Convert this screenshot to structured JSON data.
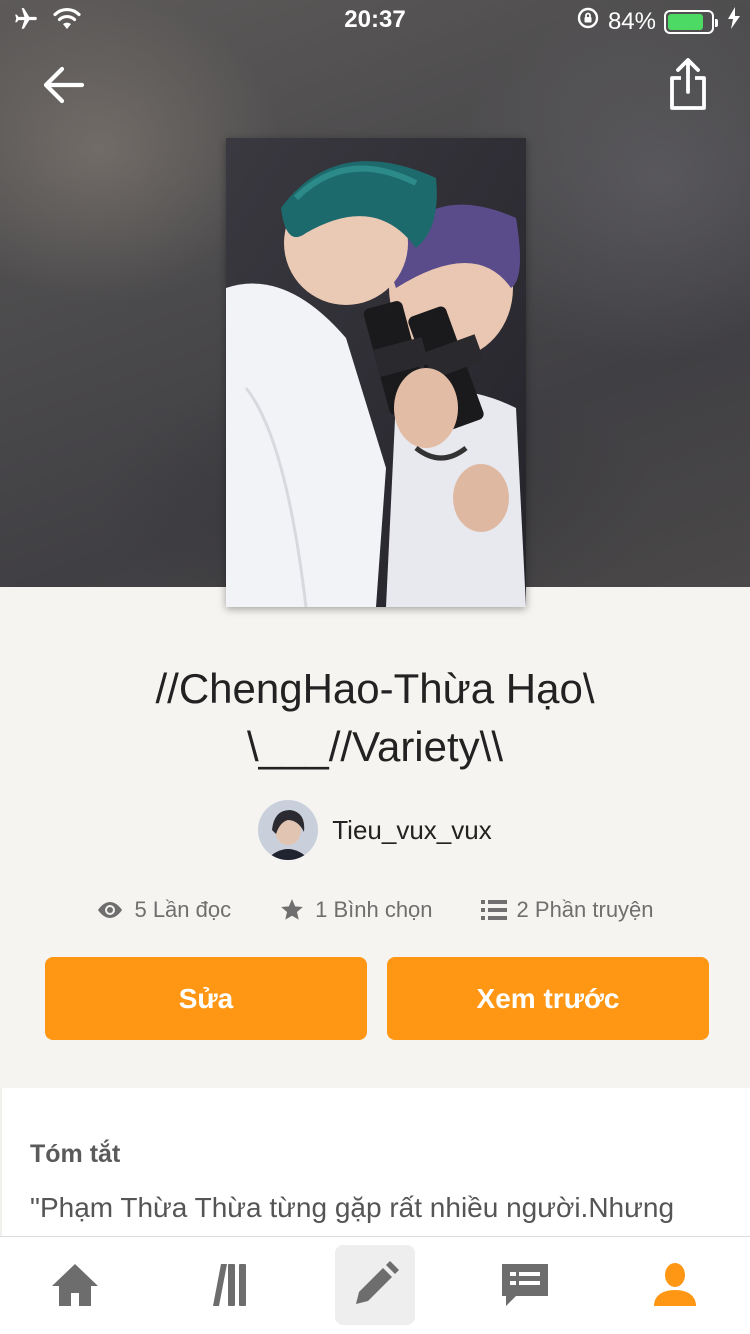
{
  "status_bar": {
    "time": "20:37",
    "battery_percent": "84%",
    "battery_level": 0.84,
    "icons": [
      "airplane-icon",
      "wifi-icon",
      "rotation-lock-icon",
      "battery-icon",
      "charging-icon"
    ]
  },
  "nav": {
    "back_icon": "arrow-left-icon",
    "share_icon": "share-icon"
  },
  "story": {
    "title": "//ChengHao-Thừa Hạo\\\n\\___//Variety\\\\",
    "author": "Tieu_vux_vux",
    "reads": "5 Lần đọc",
    "votes": "1 Bình chọn",
    "parts": "2 Phần truyện"
  },
  "actions": {
    "edit_label": "Sửa",
    "preview_label": "Xem trước"
  },
  "summary": {
    "heading": "Tóm tắt",
    "text": "\"Phạm Thừa Thừa từng gặp rất nhiều người.Nhưng"
  },
  "colors": {
    "accent": "#ff9614",
    "background": "#f5f4f0",
    "battery": "#4cd964"
  },
  "tabs": [
    {
      "name": "home",
      "icon": "home-icon"
    },
    {
      "name": "library",
      "icon": "library-icon"
    },
    {
      "name": "write",
      "icon": "pencil-icon",
      "selected": true
    },
    {
      "name": "messages",
      "icon": "chat-icon"
    },
    {
      "name": "profile",
      "icon": "user-icon",
      "active_color": "#ff9614"
    }
  ]
}
